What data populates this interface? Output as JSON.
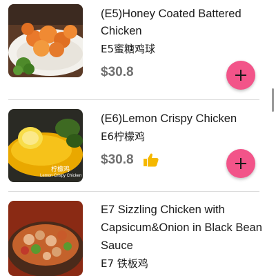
{
  "menu": {
    "items": [
      {
        "name_en_line1": "(E5)Honey Coated Battered",
        "name_en_line2": "Chicken",
        "name_cn": "E5蜜糖鸡球",
        "price": "$30.8",
        "image_icon": "honey-chicken-photo"
      },
      {
        "name_en_line1": "(E6)Lemon Crispy Chicken",
        "name_cn": "E6柠檬鸡",
        "price": "$30.8",
        "badge_icon": "thumbs-up-icon",
        "badge_color": "#f5b800",
        "image_icon": "lemon-chicken-photo",
        "image_caption_cn": "柠檬鸡",
        "image_caption_en": "Lemon Crispy Chicken"
      },
      {
        "name_en_line1": "E7 Sizzling Chicken with",
        "name_en_line2": "Capsicum&Onion in Black Bean",
        "name_en_line3": "Sauce",
        "name_cn": "E7 铁板鸡",
        "image_icon": "sizzling-chicken-photo"
      }
    ]
  },
  "colors": {
    "add_button": "#f25489",
    "price_text": "#6f6f6f",
    "divider": "#dcdcdc"
  }
}
